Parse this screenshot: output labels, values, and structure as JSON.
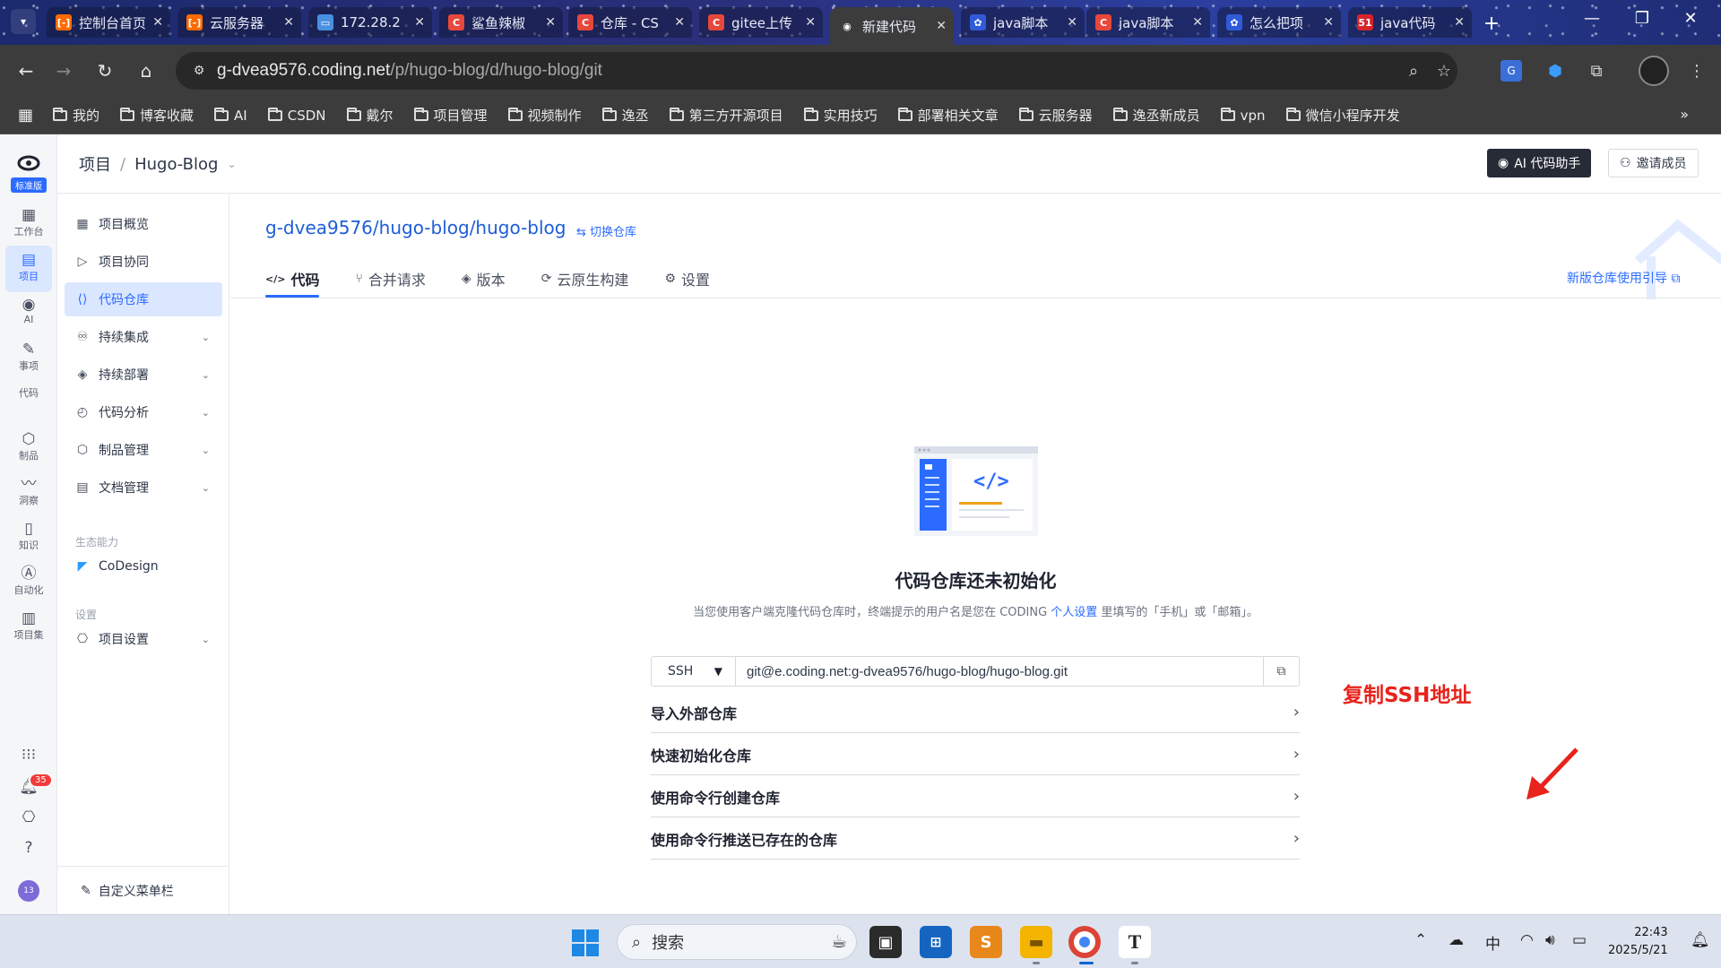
{
  "browser": {
    "tabs": [
      {
        "label": "控制台首页",
        "favicon": "bracket-icon",
        "color": "#ff6a00"
      },
      {
        "label": "云服务器",
        "favicon": "bracket-icon",
        "color": "#ff6a00"
      },
      {
        "label": "172.28.2",
        "favicon": "monitor-icon",
        "color": "#4a90e2"
      },
      {
        "label": "鲨鱼辣椒",
        "favicon": "c-icon",
        "color": "#e8473c"
      },
      {
        "label": "仓库 - CS",
        "favicon": "c-icon",
        "color": "#e8473c"
      },
      {
        "label": "gitee上传",
        "favicon": "c-icon",
        "color": "#e8473c"
      },
      {
        "label": "新建代码",
        "favicon": "coding-icon",
        "color": "#1e2330",
        "active": true
      },
      {
        "label": "java脚本",
        "favicon": "paw-icon",
        "color": "#2f5bd9"
      },
      {
        "label": "java脚本",
        "favicon": "c-icon",
        "color": "#e8473c"
      },
      {
        "label": "怎么把项",
        "favicon": "paw-icon",
        "color": "#2f5bd9"
      },
      {
        "label": "java代码",
        "favicon": "51-icon",
        "color": "#d8232a"
      }
    ],
    "url_host": "g-dvea9576.coding.net",
    "url_path": "/p/hugo-blog/d/hugo-blog/git",
    "bookmarks": [
      "我的",
      "博客收藏",
      "AI",
      "CSDN",
      "戴尔",
      "项目管理",
      "视频制作",
      "逸丞",
      "第三方开源项目",
      "实用技巧",
      "部署相关文章",
      "云服务器",
      "逸丞新成员",
      "vpn",
      "微信小程序开发"
    ]
  },
  "rail": {
    "edition": "标准版",
    "items": [
      {
        "label": "工作台",
        "icon": "dashboard-icon"
      },
      {
        "label": "项目",
        "icon": "project-icon",
        "active": true
      },
      {
        "label": "AI",
        "icon": "ai-icon"
      },
      {
        "label": "事项",
        "icon": "issue-icon"
      },
      {
        "label": "代码",
        "icon": "code-icon"
      },
      {
        "label": "制品",
        "icon": "artifact-icon"
      },
      {
        "label": "洞察",
        "icon": "insight-icon"
      },
      {
        "label": "知识",
        "icon": "knowledge-icon"
      },
      {
        "label": "自动化",
        "icon": "automation-icon"
      },
      {
        "label": "项目集",
        "icon": "program-icon"
      }
    ],
    "notification_count": "35",
    "avatar_text": "13"
  },
  "header": {
    "crumb_root": "项目",
    "crumb_sep": "/",
    "crumb_project": "Hugo-Blog",
    "ai_button": "AI 代码助手",
    "invite_button": "邀请成员"
  },
  "sidebar": {
    "items": [
      {
        "label": "项目概览"
      },
      {
        "label": "项目协同"
      },
      {
        "label": "代码仓库",
        "active": true
      },
      {
        "label": "持续集成",
        "expand": true
      },
      {
        "label": "持续部署",
        "expand": true
      },
      {
        "label": "代码分析",
        "expand": true
      },
      {
        "label": "制品管理",
        "expand": true
      },
      {
        "label": "文档管理",
        "expand": true
      }
    ],
    "group_eco": "生态能力",
    "codesign": "CoDesign",
    "group_settings": "设置",
    "project_settings": "项目设置",
    "customize": "自定义菜单栏"
  },
  "main": {
    "repo_path": "g-dvea9576/hugo-blog/hugo-blog",
    "switch_repo": "切换仓库",
    "tabs": [
      {
        "label": "代码",
        "icon": "code-icon",
        "active": true
      },
      {
        "label": "合并请求",
        "icon": "merge-icon"
      },
      {
        "label": "版本",
        "icon": "version-icon"
      },
      {
        "label": "云原生构建",
        "icon": "build-icon"
      },
      {
        "label": "设置",
        "icon": "gear-icon"
      }
    ],
    "guide_link": "新版仓库使用引导",
    "empty_title": "代码仓库还未初始化",
    "empty_desc_1": "当您使用客户端克隆代码仓库时，终端提示的用户名是您在 CODING ",
    "empty_desc_link": "个人设置",
    "empty_desc_2": " 里填写的「手机」或「邮箱」。",
    "clone_protocol": "SSH",
    "clone_url": "git@e.coding.net:g-dvea9576/hugo-blog/hugo-blog.git",
    "accordions": [
      "导入外部仓库",
      "快速初始化仓库",
      "使用命令行创建仓库",
      "使用命令行推送已存在的仓库"
    ],
    "annotation": "复制SSH地址"
  },
  "taskbar": {
    "search_placeholder": "搜索",
    "ime": "中",
    "time": "22:43",
    "date": "2025/5/21"
  }
}
